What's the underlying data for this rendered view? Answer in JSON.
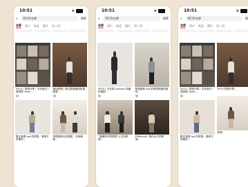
{
  "phones": [
    {
      "time": "10:51",
      "query": "哥们你去哪",
      "search_btn": "搜索",
      "tabs": [
        "全部",
        "用户",
        "商品",
        "图片",
        "问一问"
      ],
      "left_cards": [
        {
          "caption": "0919 | 穿搭分享 | 今年首位一周穿搭 clean..."
        },
        {
          "caption": "秦正美德 top 的穿搭，简单又好看的..."
        }
      ],
      "right_cards": [
        {
          "caption": "微信穿搭 | 美式穿搭潮流风搭配穿..."
        },
        {
          "caption": "穿搭短款毛衣搭配，日常通勤..."
        }
      ]
    },
    {
      "time": "10:51",
      "query": "哥们你去哪",
      "search_btn": "搜索",
      "tabs": [
        "全部",
        "用户",
        "商品",
        "图片",
        "问一问"
      ],
      "left_cards": [
        {
          "caption": "0919 | 今天穿 Lemaire 风格的搭配..."
        },
        {
          "caption": "“温暖的冬季穿搭”公主风穿搭..."
        }
      ],
      "right_cards": [
        {
          "caption": "穿搭推荐 top 的穿搭风格好看呀..."
        },
        {
          "caption": "PIDBrand | 简约大方的穿搭..."
        }
      ]
    },
    {
      "time": "10:51",
      "query": "哥们你去哪",
      "search_btn": "搜索",
      "tabs": [
        "全部",
        "用户",
        "商品",
        "图片",
        "问一问"
      ],
      "left_cards": [
        {
          "caption": "0919 | 穿搭分享 | 今年首位一周穿搭 clean..."
        },
        {
          "caption": "秦正美德 top 的穿搭，简单又好看的..."
        }
      ],
      "right_cards": [
        {
          "caption": "0919 穿搭分享..."
        },
        {
          "caption": "穿搭..."
        }
      ]
    }
  ],
  "colors": {
    "background": "#efe3d3",
    "accent": "#ff2442"
  }
}
